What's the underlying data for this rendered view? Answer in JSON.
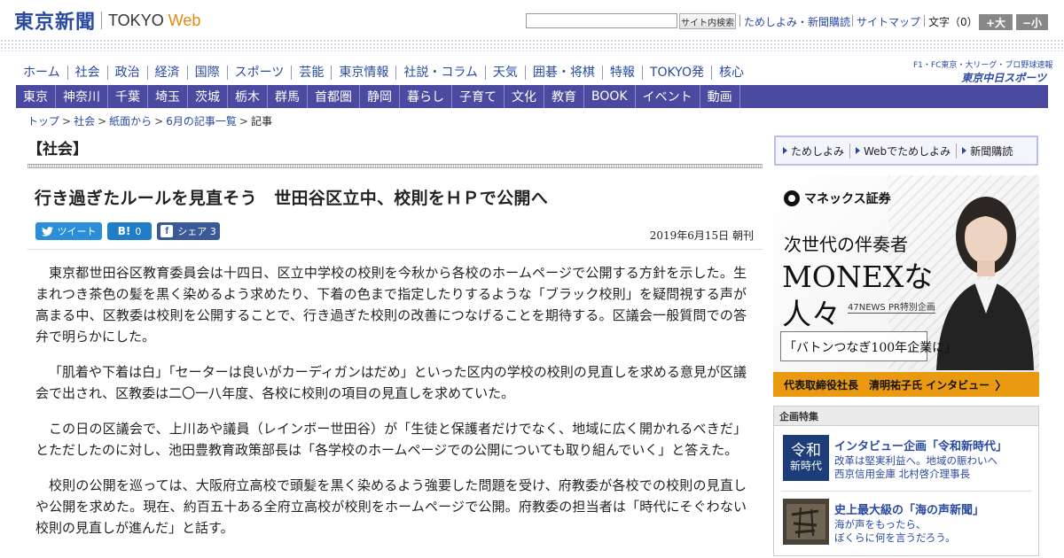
{
  "header": {
    "logo_kanji": "東京新聞",
    "logo_tokyo": "TOKYO",
    "logo_web": "Web",
    "search_value": "",
    "search_button": "サイト内検索",
    "links": [
      "ためしよみ・新聞購読",
      "サイトマップ"
    ],
    "font_label": "文字（0）",
    "font_up": "+大",
    "font_down": "−小"
  },
  "main_nav": [
    "ホーム",
    "社会",
    "政治",
    "経済",
    "国際",
    "スポーツ",
    "芸能",
    "東京情報",
    "社説・コラム",
    "天気",
    "囲碁・将棋",
    "特報",
    "TOKYO発",
    "核心"
  ],
  "chunichi": {
    "top": "F1・FC東京・大リーグ・プロ野球速報",
    "bottom": "東京中日スポーツ"
  },
  "sub_nav": [
    "東京",
    "神奈川",
    "千葉",
    "埼玉",
    "茨城",
    "栃木",
    "群馬",
    "首都圏",
    "静岡",
    "暮らし",
    "子育て",
    "文化",
    "教育",
    "BOOK",
    "イベント",
    "動画"
  ],
  "breadcrumb": [
    "トップ",
    "社会",
    "紙面から",
    "6月の記事一覧",
    "記事"
  ],
  "article": {
    "section": "【社会】",
    "headline": "行き過ぎたルールを見直そう　世田谷区立中、校則をＨＰで公開へ",
    "share": {
      "tweet": "ツイート",
      "hatena_mark": "B!",
      "hatena_count": "0",
      "fb_mark": "f",
      "fb_label": "シェア 3"
    },
    "date": "2019年6月15日 朝刊",
    "paragraphs": [
      "東京都世田谷区教育委員会は十四日、区立中学校の校則を今秋から各校のホームページで公開する方針を示した。生まれつき茶色の髪を黒く染めるよう求めたり、下着の色まで指定したりするような「ブラック校則」を疑問視する声が高まる中、区教委は校則を公開することで、行き過ぎた校則の改善につなげることを期待する。区議会一般質問での答弁で明らかにした。",
      "「肌着や下着は白」「セーターは良いがカーディガンはだめ」といった区内の学校の校則の見直しを求める意見が区議会で出され、区教委は二〇一八年度、各校に校則の項目の見直しを求めていた。",
      "この日の区議会で、上川あや議員（レインボー世田谷）が「生徒と保護者だけでなく、地域に広く開かれるべきだ」とただしたのに対し、池田豊教育政策部長は「各学校のホームページでの公開についても取り組んでいく」と答えた。",
      "校則の公開を巡っては、大阪府立高校で頭髪を黒く染めるよう強要した問題を受け、府教委が各校での校則の見直しや公開を求めた。現在、約百五十ある全府立高校が校則をホームページで公開。府教委の担当者は「時代にそぐわない校則の見直しが進んだ」と話す。"
    ]
  },
  "sidebar": {
    "promo": [
      "ためしよみ",
      "Webでためしよみ",
      "新聞購読"
    ],
    "ad": {
      "brand": "マネックス証券",
      "line1": "次世代の伴奏者",
      "line2": "MONEXな",
      "line3": "人々",
      "pr": "47NEWS PR特別企画",
      "quote": "「バトンつなぎ100年企業に」",
      "cta": "代表取締役社長　清明祐子氏 インタビュー",
      "cta_arrow": "〉"
    },
    "features": {
      "heading": "企画特集",
      "items": [
        {
          "thumb_line1": "令和",
          "thumb_line2": "新時代",
          "title": "インタビュー企画「令和新時代」",
          "sub1": "改革は堅実利益へ。地域の賑わいへ",
          "sub2": "西京信用金庫 北村啓介理事長"
        },
        {
          "title": "史上最大級の「海の声新聞」",
          "sub1": "海が声をもったら、",
          "sub2": "ぼくらに何を言うだろう。"
        }
      ]
    }
  },
  "colors": {
    "brand_blue": "#2a4aa2",
    "subnav_bg": "#4a4aa0",
    "tweet": "#2a8fd8",
    "hatena": "#1f7ec7",
    "facebook": "#3b5998",
    "ad_cta": "#e99a10"
  }
}
